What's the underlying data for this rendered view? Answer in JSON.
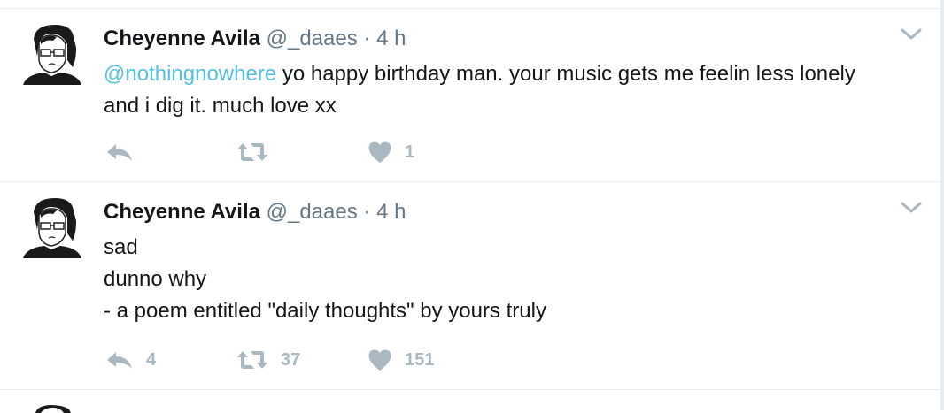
{
  "tweets": [
    {
      "name": "Cheyenne Avila",
      "handle": "@_daaes",
      "separator": "·",
      "time": "4 h",
      "mention": "@nothingnowhere",
      "lines": [
        "yo happy birthday man. your music gets me feelin less lonely",
        "and i dig it. much love xx"
      ],
      "reply_count": "",
      "retweet_count": "",
      "like_count": "1"
    },
    {
      "name": "Cheyenne Avila",
      "handle": "@_daaes",
      "separator": "·",
      "time": "4 h",
      "mention": "",
      "lines": [
        "sad",
        "dunno why",
        "- a poem entitled \"daily thoughts\" by yours truly"
      ],
      "reply_count": "4",
      "retweet_count": "37",
      "like_count": "151"
    }
  ],
  "icons": {
    "reply": "reply-icon",
    "retweet": "retweet-icon",
    "like": "heart-icon",
    "caret": "chevron-down-icon",
    "avatar": "avatar"
  },
  "colors": {
    "mention": "#55c0e0",
    "muted": "#657786",
    "action": "#aab8c2",
    "divider": "#e6ecf0"
  }
}
